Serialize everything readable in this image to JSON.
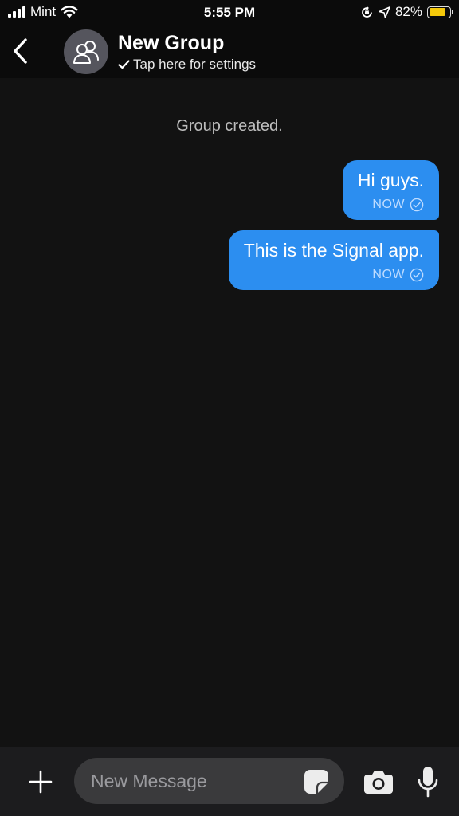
{
  "status_bar": {
    "carrier": "Mint",
    "time": "5:55 PM",
    "battery_percent": "82%",
    "battery_level": 0.82,
    "battery_color": "#f5c90a",
    "icons": [
      "signal-bars-icon",
      "wifi-icon",
      "orientation-lock-icon",
      "location-arrow-icon",
      "battery-icon"
    ]
  },
  "header": {
    "title": "New Group",
    "subtitle": "Tap here for settings",
    "back_icon": "chevron-left-icon",
    "avatar_icon": "group-people-icon",
    "subtitle_icon": "checkmark-icon"
  },
  "conversation": {
    "system_message": "Group created.",
    "messages": [
      {
        "text": "Hi guys.",
        "timestamp": "NOW",
        "status_icon": "delivered-check-icon",
        "outgoing": true
      },
      {
        "text": "This is the Signal app.",
        "timestamp": "NOW",
        "status_icon": "delivered-check-icon",
        "outgoing": true
      }
    ],
    "bubble_color": "#2c8ef0"
  },
  "composer": {
    "placeholder": "New Message",
    "value": "",
    "attach_icon": "plus-icon",
    "sticker_icon": "sticker-icon",
    "camera_icon": "camera-icon",
    "mic_icon": "microphone-icon"
  }
}
